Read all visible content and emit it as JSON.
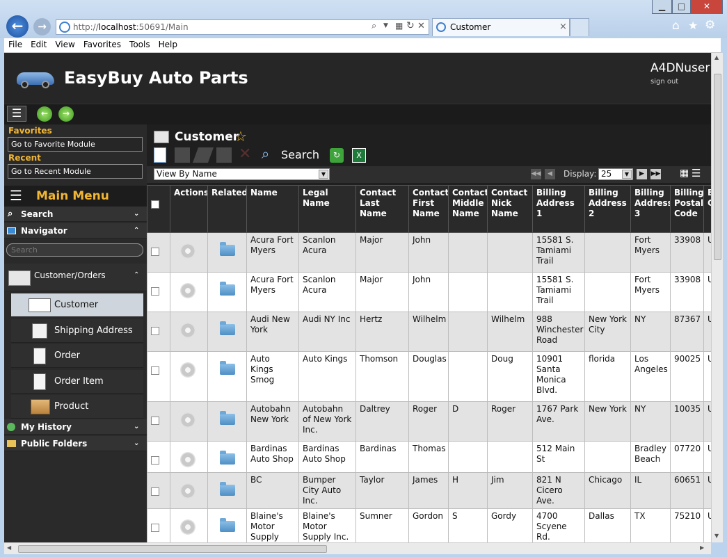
{
  "browser": {
    "url_prefix": "http://",
    "url_host": "localhost",
    "url_rest": ":50691/Main",
    "tab_title": "Customer",
    "tab_close": "×"
  },
  "menu": [
    "File",
    "Edit",
    "View",
    "Favorites",
    "Tools",
    "Help"
  ],
  "app": {
    "title": "EasyBuy Auto Parts",
    "user": "A4DNuser",
    "signout": "sign out"
  },
  "sidebar": {
    "favorites_label": "Favorites",
    "favorites_box": "Go to Favorite Module",
    "recent_label": "Recent",
    "recent_box": "Go to Recent Module",
    "main_menu": "Main Menu",
    "search": "Search",
    "navigator": "Navigator",
    "search_placeholder": "Search",
    "group": "Customer/Orders",
    "items": [
      "Customer",
      "Shipping Address",
      "Order",
      "Order Item",
      "Product"
    ],
    "history": "My History",
    "public": "Public Folders"
  },
  "main": {
    "page_title": "Customer",
    "search_label": "Search",
    "view_select": "View By Name",
    "display_label": "Display:",
    "display_value": "25"
  },
  "grid": {
    "columns": [
      "Actions",
      "Related",
      "Name",
      "Legal Name",
      "Contact Last Name",
      "Contact First Name",
      "Contact Middle Name",
      "Contact Nick Name",
      "Billing Address 1",
      "Billing Address 2",
      "Billing Address 3",
      "Billing Postal Code",
      "B C"
    ],
    "rows": [
      [
        "Acura Fort Myers",
        "Scanlon Acura",
        "Major",
        "John",
        "",
        "",
        "15581 S. Tamiami Trail",
        "",
        "Fort Myers",
        "33908",
        "U"
      ],
      [
        "Acura Fort Myers",
        "Scanlon Acura",
        "Major",
        "John",
        "",
        "",
        "15581 S. Tamiami Trail",
        "",
        "Fort Myers",
        "33908",
        "U"
      ],
      [
        "Audi New York",
        "Audi NY Inc",
        "Hertz",
        "Wilhelm",
        "",
        "Wilhelm",
        "988 Winchester Road",
        "New York City",
        "NY",
        "87367",
        "U"
      ],
      [
        "Auto Kings Smog",
        "Auto Kings",
        "Thomson",
        "Douglas",
        "",
        "Doug",
        "10901 Santa Monica Blvd.",
        "florida",
        "Los Angeles",
        "90025",
        "U"
      ],
      [
        "Autobahn New York",
        "Autobahn of New York Inc.",
        "Daltrey",
        "Roger",
        "D",
        "Roger",
        "1767 Park Ave.",
        "New York",
        "NY",
        "10035",
        "U"
      ],
      [
        "Bardinas Auto Shop",
        "Bardinas Auto Shop",
        "Bardinas",
        "Thomas",
        "",
        "",
        "512 Main St",
        "",
        "Bradley Beach",
        "07720",
        "U"
      ],
      [
        "BC",
        "Bumper City Auto Inc.",
        "Taylor",
        "James",
        "H",
        "Jim",
        "821 N Cicero Ave.",
        "Chicago",
        "IL",
        "60651",
        "U"
      ],
      [
        "Blaine's Motor Supply",
        "Blaine's Motor Supply Inc.",
        "Sumner",
        "Gordon",
        "S",
        "Gordy",
        "4700 Scyene Rd.",
        "Dallas",
        "TX",
        "75210",
        "U"
      ]
    ]
  }
}
